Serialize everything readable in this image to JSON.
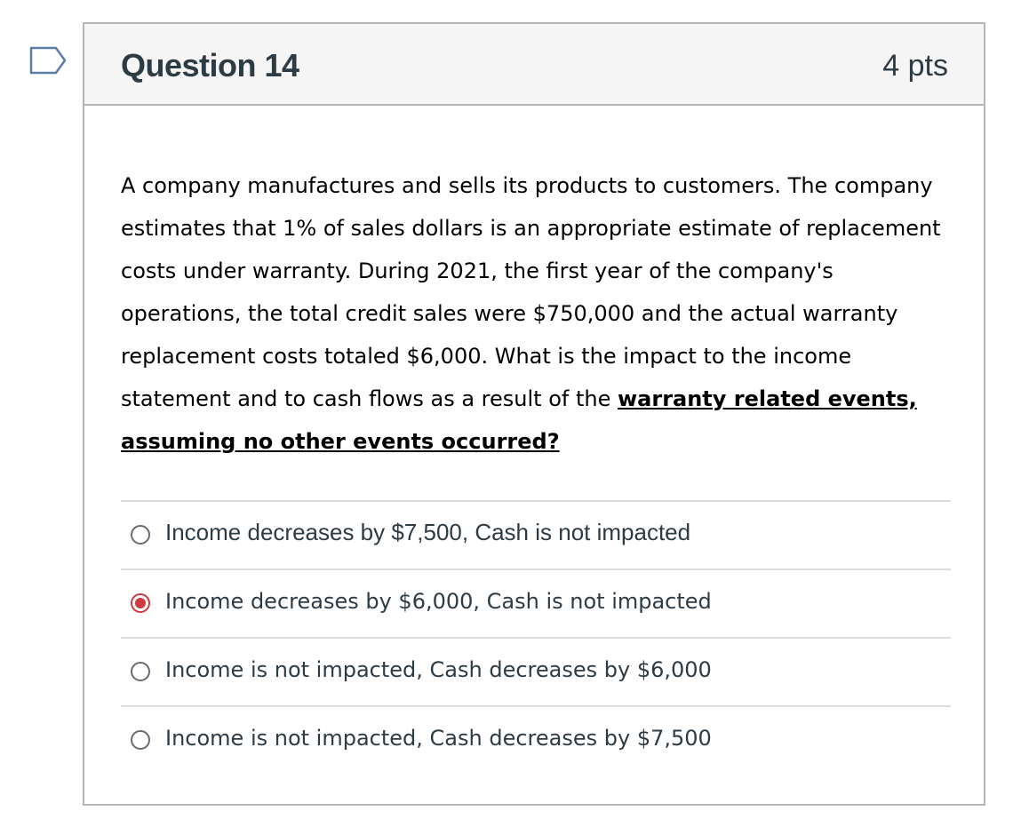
{
  "question": {
    "title": "Question 14",
    "points": "4 pts",
    "body_parts": [
      "A company manufactures and sells its products to customers.  The company estimates that 1% of sales dollars is an appropriate estimate of replacement costs under warranty.  During 2021, the first year of the company's operations, the total credit sales were $750,000 and the actual warranty replacement costs totaled $6,000.  What is the impact to the income statement and to cash flows as a result of the ",
      "warranty related events, assuming no other events occurred?"
    ]
  },
  "answers": [
    {
      "label": "Income decreases by $7,500, Cash is not impacted",
      "selected": false
    },
    {
      "label": "Income decreases by $6,000, Cash is not impacted",
      "selected": true
    },
    {
      "label": "Income is not impacted, Cash decreases by $6,000",
      "selected": false
    },
    {
      "label": "Income is not impacted, Cash decreases by $7,500",
      "selected": false
    }
  ],
  "icons": {
    "flag": "bookmark-flag-icon"
  },
  "colors": {
    "selected_radio": "#d0393e",
    "header_bg": "#f5f5f5",
    "border": "#b5b5b5"
  }
}
